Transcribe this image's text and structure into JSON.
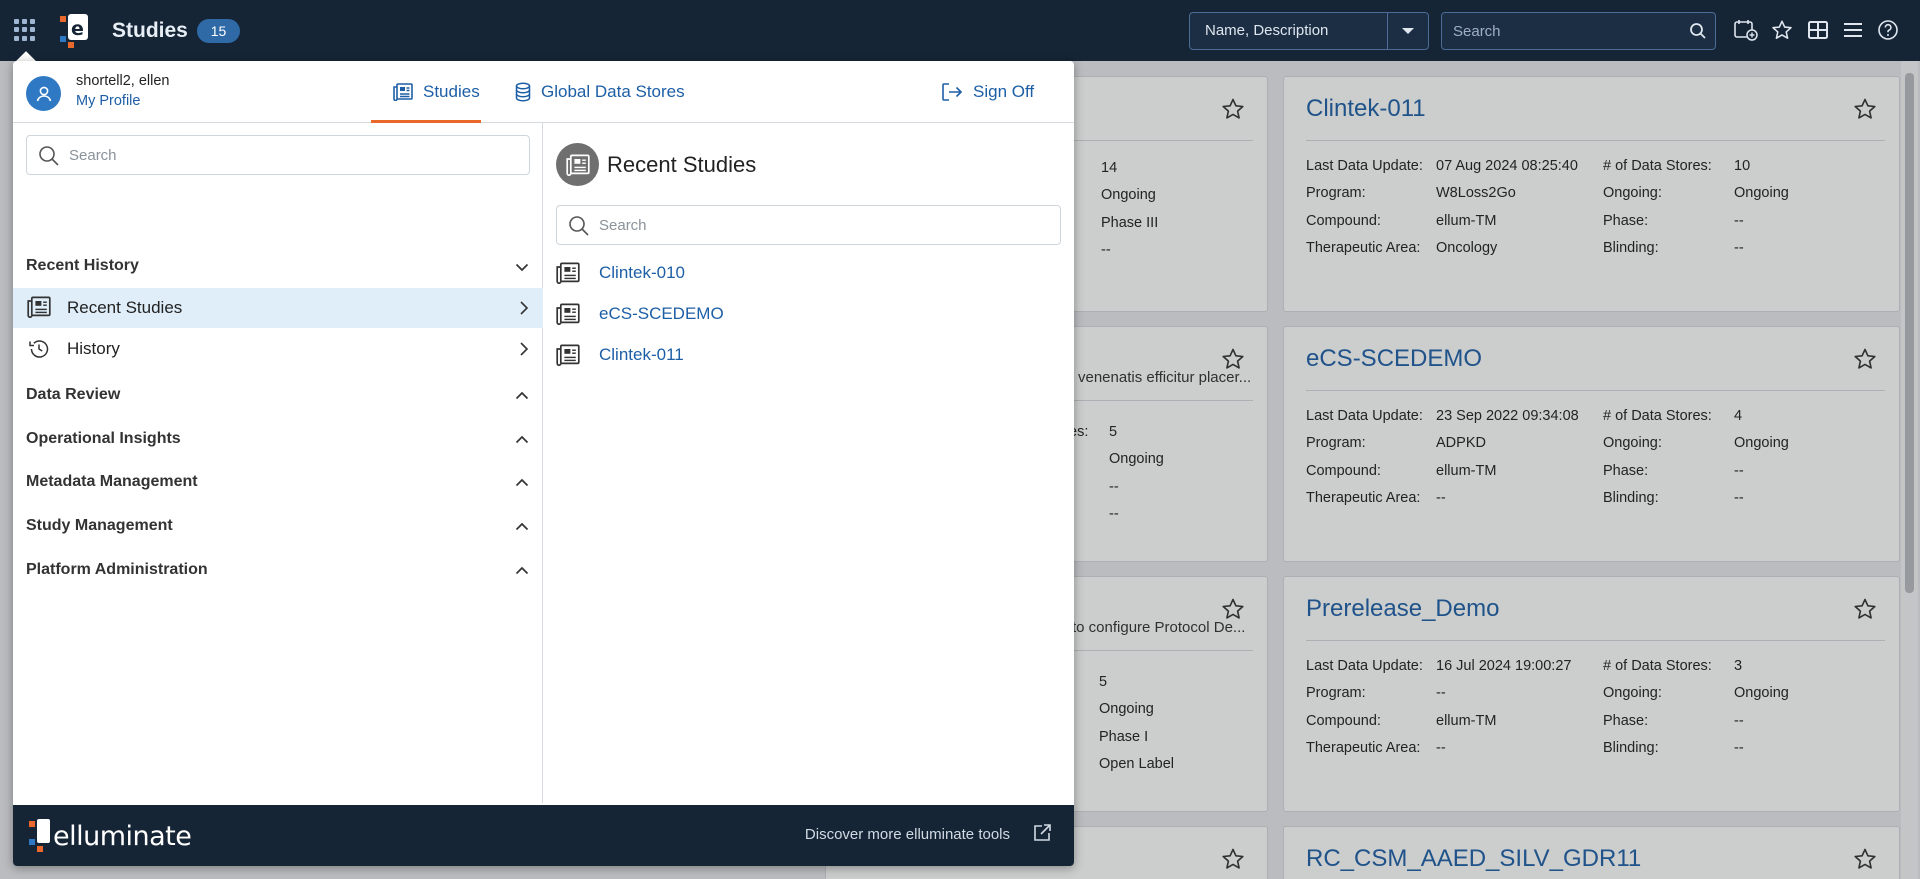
{
  "header": {
    "title": "Studies",
    "count": "15",
    "filter_value": "Name, Description",
    "search_placeholder": "Search"
  },
  "icons": {
    "apps": "apps-grid-icon",
    "logo": "elluminate-logo-icon",
    "add_study": "calendar-add-icon",
    "favorites": "star-icon",
    "tile_view": "grid-view-icon",
    "list_view": "list-view-icon",
    "help": "help-icon"
  },
  "colors": {
    "topbar": "#152536",
    "accent_tab": "#e9692c",
    "link": "#1d5fa6",
    "selected_row": "#dfeef9"
  },
  "flyout": {
    "user_name": "shortell2, ellen",
    "profile_link": "My Profile",
    "tabs": [
      {
        "label": "Studies"
      },
      {
        "label": "Global Data Stores"
      }
    ],
    "sign_off": "Sign Off",
    "left": {
      "search_placeholder": "Search",
      "sections": [
        {
          "label": "Recent History"
        },
        {
          "label": "Data Review"
        },
        {
          "label": "Operational Insights"
        },
        {
          "label": "Metadata Management"
        },
        {
          "label": "Study Management"
        },
        {
          "label": "Platform Administration"
        }
      ],
      "items": [
        {
          "label": "Recent Studies"
        },
        {
          "label": "History"
        }
      ]
    },
    "right": {
      "title": "Recent Studies",
      "search_placeholder": "Search",
      "studies": [
        {
          "label": "Clintek-010"
        },
        {
          "label": "eCS-SCEDEMO"
        },
        {
          "label": "Clintek-011"
        }
      ]
    },
    "footer": {
      "brand": "elluminate",
      "discover": "Discover more elluminate tools"
    }
  },
  "cards": {
    "labels": {
      "last_update": "Last Data Update:",
      "program": "Program:",
      "compound": "Compound:",
      "therapeutic": "Therapeutic Area:",
      "data_stores": "# of Data Stores:",
      "ongoing": "Ongoing:",
      "phase": "Phase:",
      "blinding": "Blinding:"
    },
    "right_col": [
      {
        "title": "Clintek-011",
        "last_update": "07 Aug 2024 08:25:40",
        "program": "W8Loss2Go",
        "compound": "ellum-TM",
        "therapeutic": "Oncology",
        "data_stores": "10",
        "ongoing": "Ongoing",
        "phase": "--",
        "blinding": "--"
      },
      {
        "title": "eCS-SCEDEMO",
        "last_update": "23 Sep 2022 09:34:08",
        "program": "ADPKD",
        "compound": "ellum-TM",
        "therapeutic": "--",
        "data_stores": "4",
        "ongoing": "Ongoing",
        "phase": "--",
        "blinding": "--"
      },
      {
        "title": "Prerelease_Demo",
        "last_update": "16 Jul 2024 19:00:27",
        "program": "--",
        "compound": "ellum-TM",
        "therapeutic": "--",
        "data_stores": "3",
        "ongoing": "Ongoing",
        "phase": "--",
        "blinding": "--"
      },
      {
        "title": "RC_CSM_AAED_SILV_GDR11"
      }
    ],
    "partial_col": [
      {
        "label_tail": ":",
        "values": [
          "14",
          "Ongoing",
          "Phase III",
          "--"
        ]
      },
      {
        "desc": "venenatis efficitur placer...",
        "label_tail": "es:",
        "values": [
          "5",
          "Ongoing",
          "--",
          "--"
        ]
      },
      {
        "desc": "to configure Protocol De...",
        "label_tail": ":",
        "values": [
          "5",
          "Ongoing",
          "Phase I",
          "Open Label"
        ]
      }
    ]
  }
}
